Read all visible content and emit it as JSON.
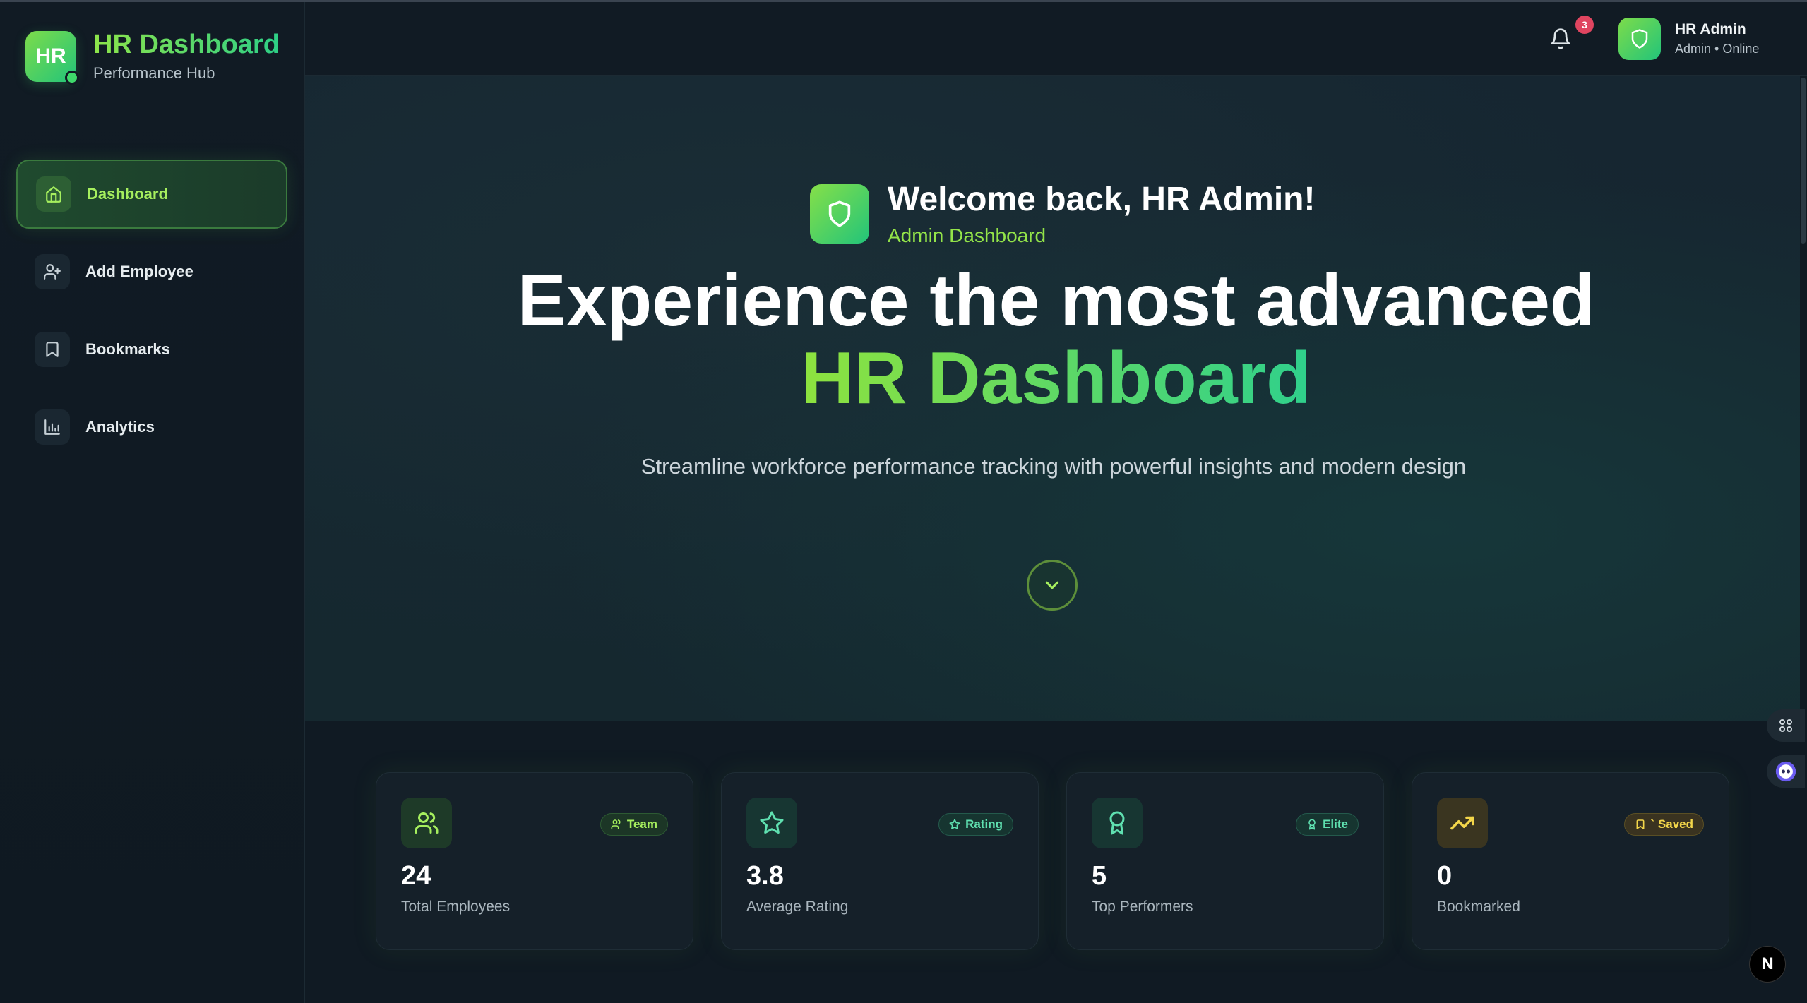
{
  "brand": {
    "logo_text": "HR",
    "title": "HR Dashboard",
    "subtitle": "Performance Hub"
  },
  "sidebar": {
    "items": [
      {
        "label": "Dashboard",
        "icon": "home-icon",
        "active": true
      },
      {
        "label": "Add Employee",
        "icon": "user-plus-icon",
        "active": false
      },
      {
        "label": "Bookmarks",
        "icon": "bookmark-icon",
        "active": false
      },
      {
        "label": "Analytics",
        "icon": "bar-chart-icon",
        "active": false
      }
    ]
  },
  "header": {
    "notifications_count": "3",
    "user": {
      "name": "HR Admin",
      "status": "Admin • Online"
    }
  },
  "hero": {
    "welcome_title": "Welcome back, HR Admin!",
    "welcome_subtitle": "Admin Dashboard",
    "headline_line1": "Experience the most advanced",
    "headline_line2": "HR Dashboard",
    "description": "Streamline workforce performance tracking with powerful insights and modern design"
  },
  "stats": [
    {
      "value": "24",
      "label": "Total Employees",
      "tag": "Team",
      "icon": "users-icon",
      "tag_icon": "users-icon"
    },
    {
      "value": "3.8",
      "label": "Average Rating",
      "tag": "Rating",
      "icon": "star-icon",
      "tag_icon": "star-icon"
    },
    {
      "value": "5",
      "label": "Top Performers",
      "tag": "Elite",
      "icon": "award-icon",
      "tag_icon": "award-icon"
    },
    {
      "value": "0",
      "label": "Bookmarked",
      "tag": "` Saved",
      "icon": "trending-up-icon",
      "tag_icon": "bookmark-icon"
    }
  ],
  "floating": {
    "dev_badge": "N"
  },
  "colors": {
    "accent_green": "#8ee44a",
    "accent_teal": "#2dcf86",
    "badge_red": "#e04560",
    "accent_yellow": "#f3d64a"
  }
}
